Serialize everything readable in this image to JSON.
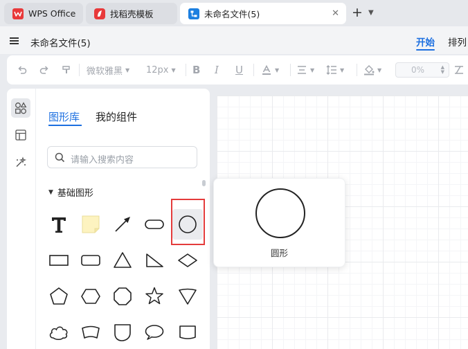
{
  "tabs": [
    {
      "label": "WPS Office",
      "icon": "wps-logo-icon",
      "color": "#e8393a"
    },
    {
      "label": "找稻壳模板",
      "icon": "docer-logo-icon",
      "color": "#e8393a"
    },
    {
      "label": "未命名文件(5)",
      "icon": "flowchart-doc-icon",
      "color": "#1c7fe0",
      "active": true
    }
  ],
  "tab_new": "+",
  "titlebar": {
    "doc_title": "未命名文件(5)",
    "tabs": [
      {
        "label": "开始",
        "active": true
      },
      {
        "label": "排列"
      }
    ],
    "accent": "#1c6fe0"
  },
  "toolbar": {
    "font_family": "微软雅黑",
    "font_size": "12px",
    "zoom_value": "0%"
  },
  "panel": {
    "tabs": [
      {
        "label": "图形库",
        "active": true
      },
      {
        "label": "我的组件"
      }
    ],
    "search_placeholder": "请输入搜索内容",
    "category": "基础图形",
    "selected_shape": "circle"
  },
  "preview": {
    "label": "圆形"
  },
  "colors": {
    "selection_border": "#e43b3b",
    "note_fill": "#fdf3c0"
  }
}
